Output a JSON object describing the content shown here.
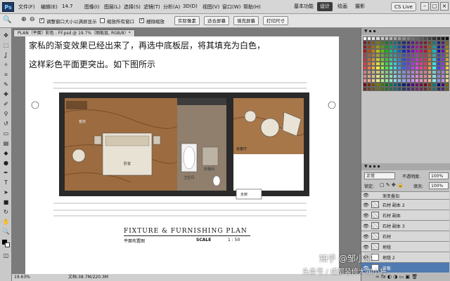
{
  "menubar": {
    "logo": "Ps",
    "menus": [
      "文件(F)",
      "编辑(E)",
      "图像(I)",
      "图层(L)",
      "选择(S)",
      "滤镜(T)",
      "分析(A)",
      "3D(D)",
      "视图(V)",
      "窗口(W)",
      "帮助(H)"
    ],
    "zoom": "14.7",
    "workspace_buttons": [
      "基本功能",
      "设计",
      "绘画",
      "摄影"
    ],
    "active_workspace": "设计",
    "cs_live": "CS Live"
  },
  "options": {
    "check1": "调整窗口大小以满屏显示",
    "check2": "缩放所有窗口",
    "check3": "细微缩放",
    "btn_actual": "实际像素",
    "btn_fit": "适合屏幕",
    "btn_fill": "填充屏幕",
    "btn_print": "打印尺寸"
  },
  "document": {
    "tab": "PLAN（平面）彩色 - FF.psd @ 19.7%（图板层, RGB/8）*",
    "caption_line1": "家私的渐变效果已经出来了，再选中底板层，将其填充为白色，",
    "caption_line2": "这样彩色平面更突出。如下图所示",
    "plan_title": "FIXTURE & FURNISHING PLAN",
    "plan_subtitle": "平面布置图",
    "scale_label": "SCALE",
    "scale_value": "1 : 50",
    "room_labels": [
      "会客厅",
      "卧室",
      "卫生间",
      "衣帽间",
      "客房",
      "走廊"
    ]
  },
  "status": {
    "zoom": "19.63%",
    "doc": "文档:38.7M/220.3M"
  },
  "layers": {
    "blend_mode": "正常",
    "opacity_label": "不透明度:",
    "opacity_value": "100%",
    "lock_label": "锁定:",
    "fill_label": "填充:",
    "fill_value": "100%",
    "items": [
      {
        "name": "渐变叠加",
        "selected": false
      },
      {
        "name": "石材 副本 2",
        "selected": false
      },
      {
        "name": "石材 副本",
        "selected": false
      },
      {
        "name": "石材 副本 3",
        "selected": false
      },
      {
        "name": "石材",
        "selected": false
      },
      {
        "name": "地毯",
        "selected": false
      },
      {
        "name": "地毯 2",
        "selected": false
      },
      {
        "name": "底板",
        "selected": true
      }
    ]
  },
  "watermark": {
    "line1": "知乎 @邹小将",
    "line2": "头条号 / 成都装修大咖小将"
  },
  "colors": {
    "menubar_bg": "#d6d6d6",
    "workspace_bg": "#7b7b7b",
    "selected_layer": "#4f7ab2"
  }
}
